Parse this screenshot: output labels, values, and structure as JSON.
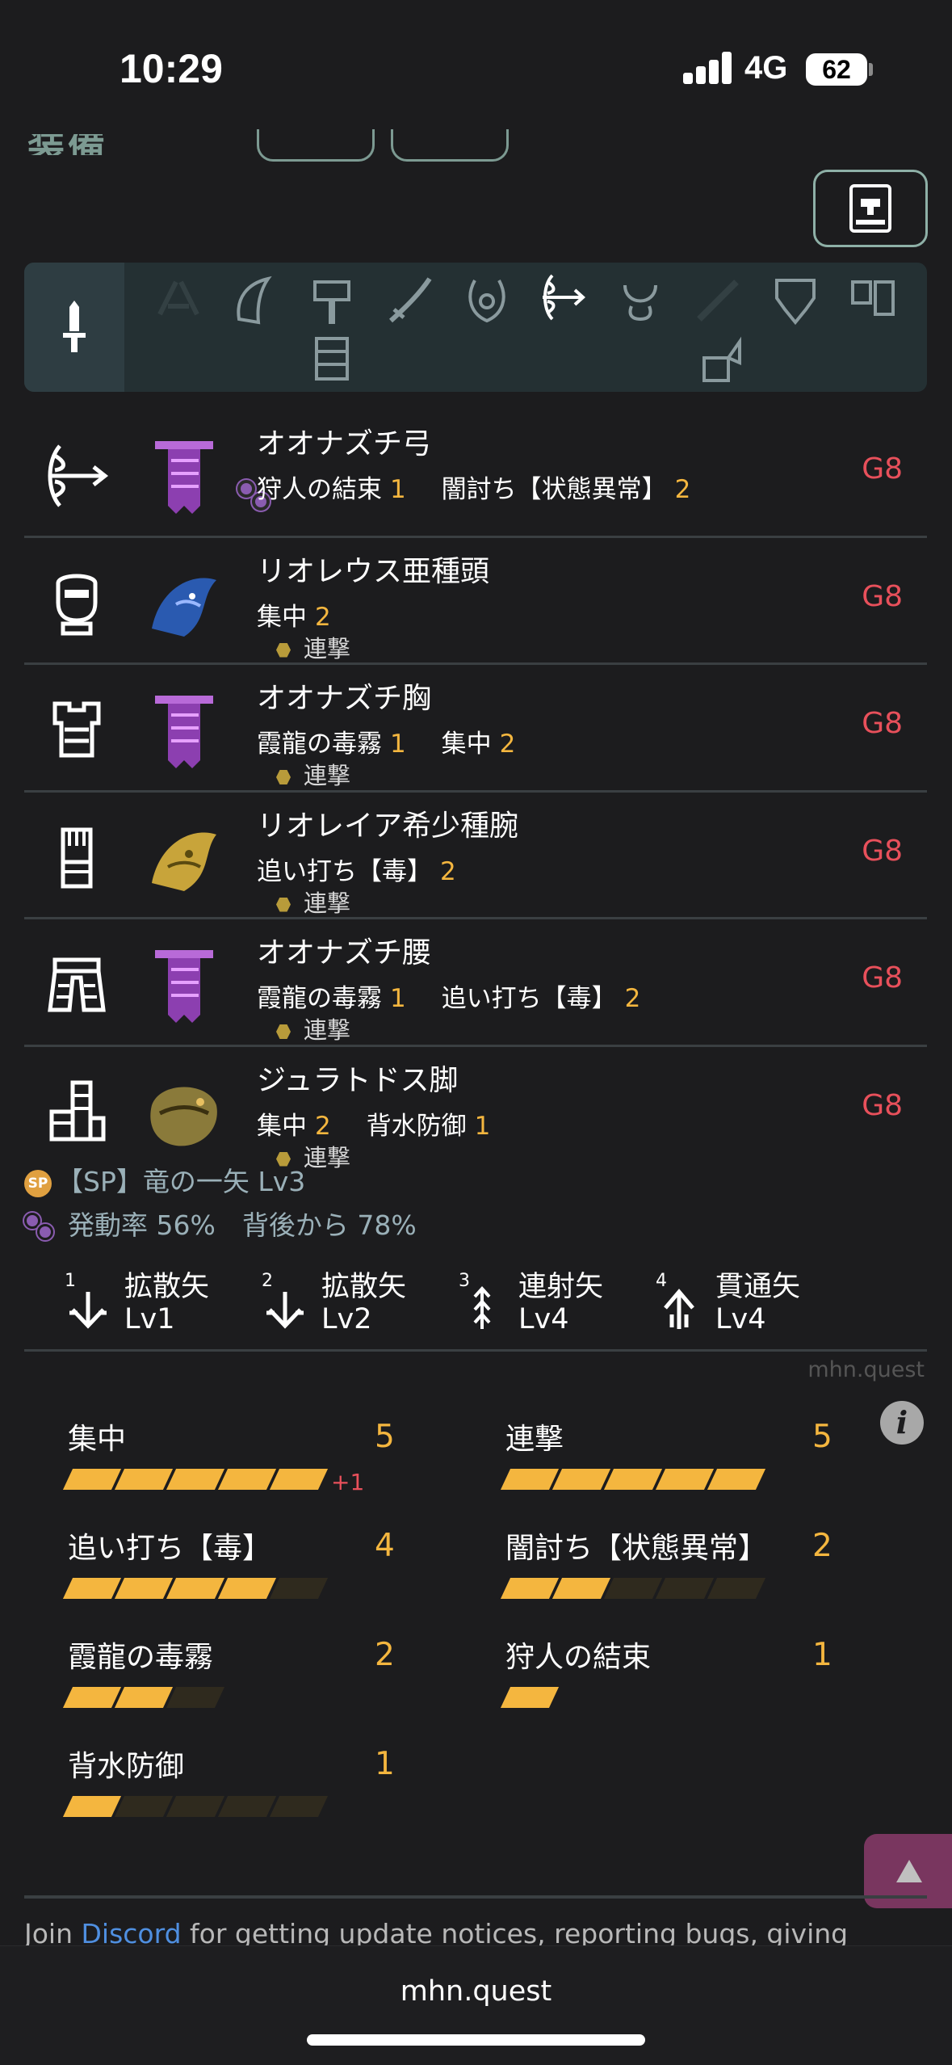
{
  "status_bar": {
    "time": "10:29",
    "network": "4G",
    "battery": "62"
  },
  "armor": [
    {
      "slot_icon": "bow-weapon-icon",
      "name": "オオナズチ弓",
      "monster": "chameleos",
      "color": "#9a4fc0",
      "skills": [
        {
          "name": "狩人の結束",
          "lv": "1"
        },
        {
          "name": "闇討ち【状態異常】",
          "lv": "2"
        }
      ],
      "deco": "",
      "grade": "G8"
    },
    {
      "slot_icon": "helmet-icon",
      "name": "リオレウス亜種頭",
      "monster": "azure-rathalos",
      "color": "#2a5ab0",
      "skills": [
        {
          "name": "集中",
          "lv": "2"
        }
      ],
      "deco": "連撃",
      "grade": "G8"
    },
    {
      "slot_icon": "chest-armor-icon",
      "name": "オオナズチ胸",
      "monster": "chameleos",
      "color": "#9a4fc0",
      "skills": [
        {
          "name": "霞龍の毒霧",
          "lv": "1"
        },
        {
          "name": "集中",
          "lv": "2"
        }
      ],
      "deco": "連撃",
      "grade": "G8"
    },
    {
      "slot_icon": "gauntlet-icon",
      "name": "リオレイア希少種腕",
      "monster": "gold-rathian",
      "color": "#c8a43a",
      "skills": [
        {
          "name": "追い打ち【毒】",
          "lv": "2"
        }
      ],
      "deco": "連撃",
      "grade": "G8"
    },
    {
      "slot_icon": "waist-armor-icon",
      "name": "オオナズチ腰",
      "monster": "chameleos",
      "color": "#9a4fc0",
      "skills": [
        {
          "name": "霞龍の毒霧",
          "lv": "1"
        },
        {
          "name": "追い打ち【毒】",
          "lv": "2"
        }
      ],
      "deco": "連撃",
      "grade": "G8"
    },
    {
      "slot_icon": "leg-armor-icon",
      "name": "ジュラトドス脚",
      "monster": "jyuratodus",
      "color": "#8a7a3a",
      "skills": [
        {
          "name": "集中",
          "lv": "2"
        },
        {
          "name": "背水防御",
          "lv": "1"
        }
      ],
      "deco": "連撃",
      "grade": "G8"
    }
  ],
  "sp": {
    "badge": "SP",
    "text": "【SP】竜の一矢 Lv3"
  },
  "rates": {
    "text": "発動率 56%　背後から 78%"
  },
  "arrows": [
    {
      "num": "1",
      "name": "拡散矢",
      "lv": "Lv1",
      "icon": "spread-arrow-icon"
    },
    {
      "num": "2",
      "name": "拡散矢",
      "lv": "Lv2",
      "icon": "spread-arrow-icon"
    },
    {
      "num": "3",
      "name": "連射矢",
      "lv": "Lv4",
      "icon": "rapid-arrow-icon"
    },
    {
      "num": "4",
      "name": "貫通矢",
      "lv": "Lv4",
      "icon": "pierce-arrow-icon"
    }
  ],
  "watermark": "mhn.quest",
  "info_icon": "i",
  "skill_summary": [
    {
      "name": "集中",
      "level": "5",
      "filled": 5,
      "bonus": "+1"
    },
    {
      "name": "連撃",
      "level": "5",
      "filled": 5,
      "bonus": ""
    },
    {
      "name": "追い打ち【毒】",
      "level": "4",
      "filled": 4,
      "bonus": ""
    },
    {
      "name": "闇討ち【状態異常】",
      "level": "2",
      "filled": 2,
      "bonus": ""
    },
    {
      "name": "霞龍の毒霧",
      "level": "2",
      "filled": 2,
      "max": 3,
      "bonus": ""
    },
    {
      "name": "狩人の結束",
      "level": "1",
      "filled": 1,
      "max": 1,
      "bonus": ""
    },
    {
      "name": "背水防御",
      "level": "1",
      "filled": 1,
      "bonus": ""
    }
  ],
  "footer": {
    "prefix": "Join ",
    "link": "Discord",
    "suffix": " for getting update notices, reporting bugs, giving"
  },
  "url": "mhn.quest",
  "colors": {
    "background": "#1c1c1e",
    "accent": "#f4b63f",
    "grade": "#e8505b",
    "link": "#4f8fe0"
  }
}
